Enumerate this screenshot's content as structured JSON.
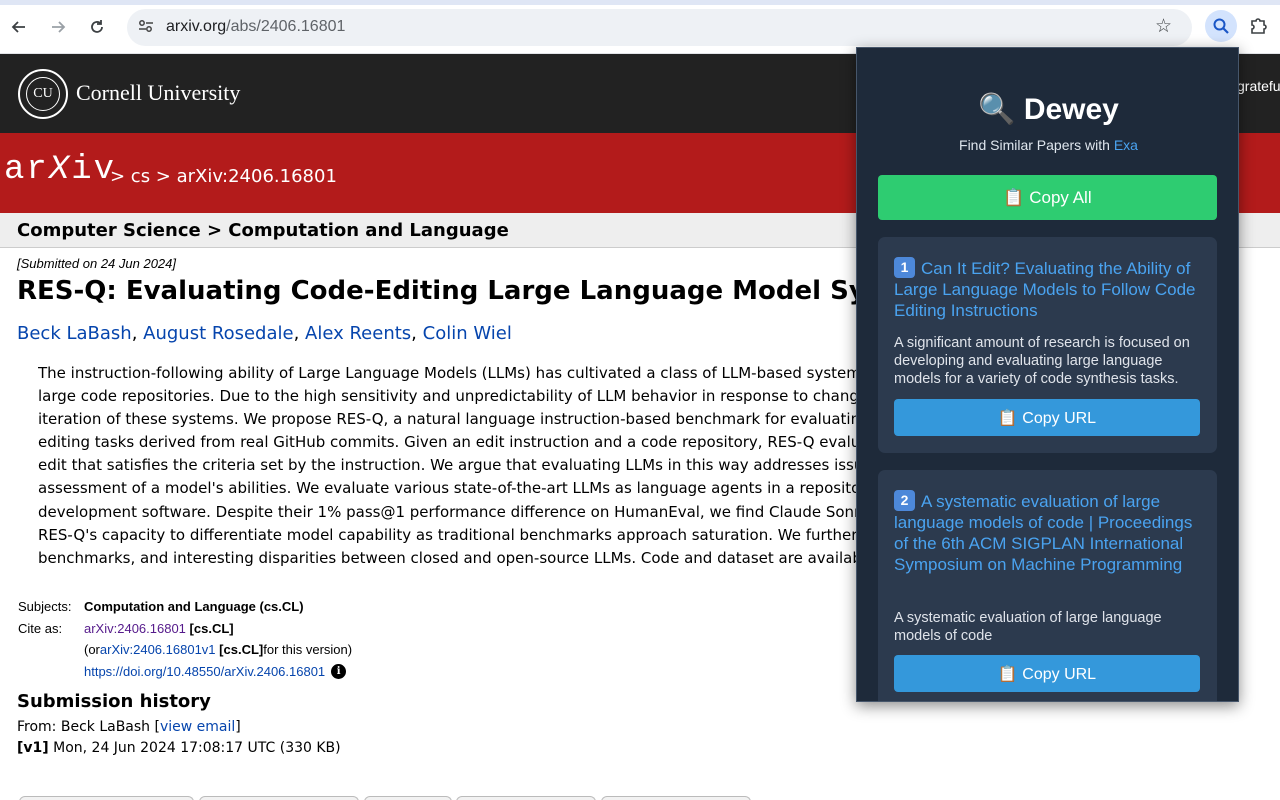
{
  "browser": {
    "url_host": "arxiv.org",
    "url_path": "/abs/2406.16801",
    "back_icon": "arrow-left-icon",
    "forward_icon": "arrow-right-icon",
    "reload_icon": "reload-icon",
    "site_settings_icon": "tune-icon",
    "bookmark_icon": "star-icon",
    "extension_icon": "magnifier-icon",
    "extensions_menu_icon": "puzzle-icon"
  },
  "cornell": {
    "name": "Cornell University",
    "seal_text": "CU",
    "gratitude_partial": "gratefu"
  },
  "arxiv_bar": {
    "logo_pre": "ar",
    "logo_x": "X",
    "logo_post": "iv",
    "crumb": "> cs > arXiv:2406.16801"
  },
  "subject_heading": "Computer Science > Computation and Language",
  "paper": {
    "submitted": "[Submitted on 24 Jun 2024]",
    "title": "RES-Q: Evaluating Code-Editing Large Language Model Systems",
    "authors": [
      "Beck LaBash",
      "August Rosedale",
      "Alex Reents",
      "Colin Wiel"
    ],
    "author_sep": ", ",
    "abstract_lines": [
      "The instruction-following ability of Large Language Models (LLMs) has cultivated a class of LLM-based systems ca                                                                                                         edits",
      "large code repositories. Due to the high sensitivity and unpredictability of LLM behavior in response to changes in                                                                                                       rive fu",
      "iteration of these systems. We propose RES-Q, a natural language instruction-based benchmark for evaluating R                                                                                                          ositor",
      "editing tasks derived from real GitHub commits. Given an edit instruction and a code repository, RES-Q evaluates                                                                                                       nstruc",
      "edit that satisfies the criteria set by the instruction. We argue that evaluating LLMs in this way addresses issues w                                                                                                 tic",
      "assessment of a model's abilities. We evaluate various state-of-the-art LLMs as language agents in a repository-e                                                                                                    nt",
      "development software. Despite their 1% pass@1 performance difference on HumanEval, we find Claude Sonnet 3.5                                                                                                       icating",
      "RES-Q's capacity to differentiate model capability as traditional benchmarks approach saturation. We further inve                                                                                                 th exi",
      "benchmarks, and interesting disparities between closed and open-source LLMs. Code and dataset are available at"
    ]
  },
  "meta": {
    "subjects_label": "Subjects:",
    "subjects_value": "Computation and Language (cs.CL)",
    "cite_label": "Cite as:",
    "cite_id": "arXiv:2406.16801",
    "cite_cat": "[cs.CL]",
    "or_prefix": "(or ",
    "cite_v1": "arXiv:2406.16801v1",
    "cite_v1_cat": "[cs.CL]",
    "or_suffix": " for this version)",
    "doi": "https://doi.org/10.48550/arXiv.2406.16801",
    "info_glyph": "i"
  },
  "history": {
    "title": "Submission history",
    "from_prefix": "From: Beck LaBash [",
    "view_email": "view email",
    "from_suffix": "]",
    "v1_label": "[v1]",
    "v1_text": " Mon, 24 Jun 2024 17:08:17 UTC (330 KB)"
  },
  "dewey": {
    "icon": "magnifier-icon",
    "title": "🔍 Dewey",
    "subtitle_prefix": "Find Similar Papers with ",
    "subtitle_link": "Exa",
    "copy_all": "📋 Copy All",
    "results": [
      {
        "num": "1",
        "title": "Can It Edit? Evaluating the Ability of Large Language Models to Follow Code Editing Instructions",
        "desc": "A significant amount of research is focused on developing and evaluating large language models for a variety of code synthesis tasks.",
        "copy_url": "📋 Copy URL"
      },
      {
        "num": "2",
        "title": "A systematic evaluation of large language models of code | Proceedings of the 6th ACM SIGPLAN International Symposium on Machine Programming",
        "desc": "A systematic evaluation of large language models of code",
        "copy_url": "📋 Copy URL"
      }
    ]
  },
  "colors": {
    "cornell_bg": "#222222",
    "arxiv_red": "#b31b1b",
    "link_blue": "#0645ad",
    "dewey_bg": "#1e2a3a",
    "dewey_card": "#2c3a4e",
    "copy_all_green": "#2ecc71",
    "copy_url_blue": "#3498db"
  }
}
